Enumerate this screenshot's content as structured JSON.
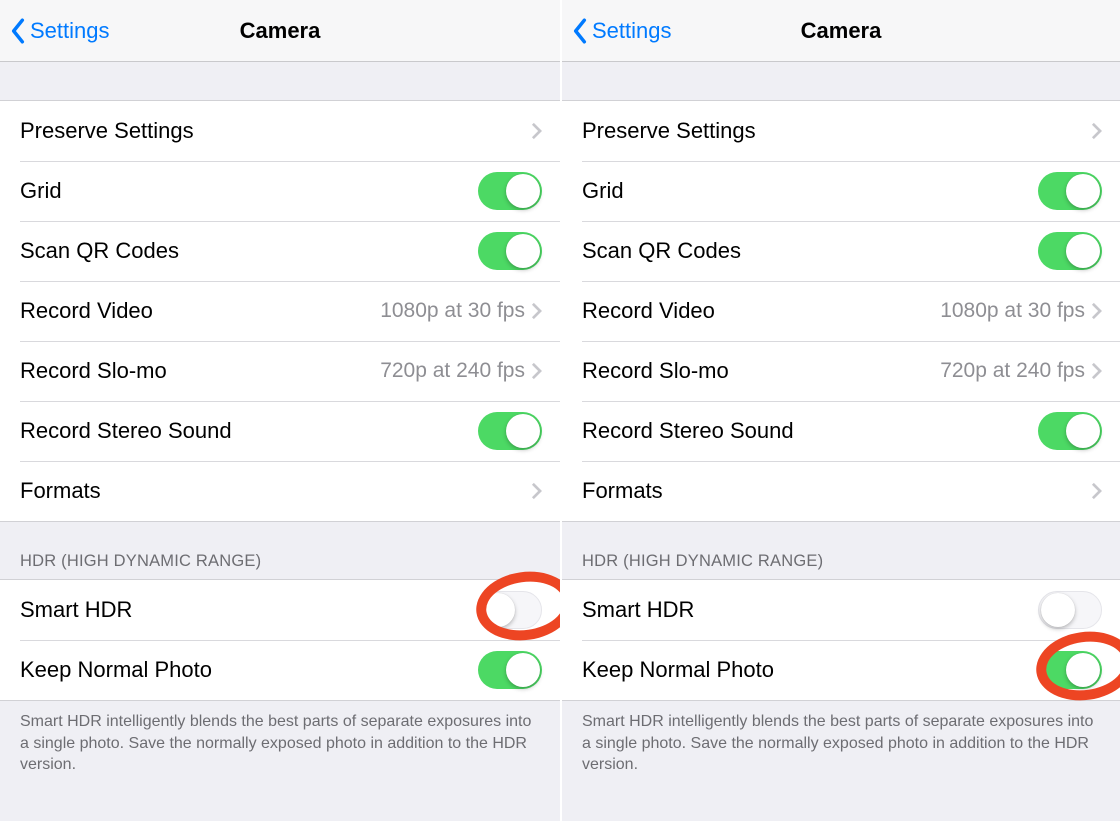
{
  "panels": [
    {
      "back_label": "Settings",
      "title": "Camera",
      "section1": {
        "rows": [
          {
            "kind": "nav",
            "label": "Preserve Settings"
          },
          {
            "kind": "toggle",
            "label": "Grid",
            "on": true
          },
          {
            "kind": "toggle",
            "label": "Scan QR Codes",
            "on": true
          },
          {
            "kind": "nav",
            "label": "Record Video",
            "detail": "1080p at 30 fps"
          },
          {
            "kind": "nav",
            "label": "Record Slo-mo",
            "detail": "720p at 240 fps"
          },
          {
            "kind": "toggle",
            "label": "Record Stereo Sound",
            "on": true
          },
          {
            "kind": "nav",
            "label": "Formats"
          }
        ]
      },
      "section2": {
        "header": "HDR (HIGH DYNAMIC RANGE)",
        "rows": [
          {
            "kind": "toggle",
            "label": "Smart HDR",
            "on": false,
            "circled": true
          },
          {
            "kind": "toggle",
            "label": "Keep Normal Photo",
            "on": true
          }
        ],
        "footer": "Smart HDR intelligently blends the best parts of separate exposures into a single photo. Save the normally exposed photo in addition to the HDR version."
      }
    },
    {
      "back_label": "Settings",
      "title": "Camera",
      "section1": {
        "rows": [
          {
            "kind": "nav",
            "label": "Preserve Settings"
          },
          {
            "kind": "toggle",
            "label": "Grid",
            "on": true
          },
          {
            "kind": "toggle",
            "label": "Scan QR Codes",
            "on": true
          },
          {
            "kind": "nav",
            "label": "Record Video",
            "detail": "1080p at 30 fps"
          },
          {
            "kind": "nav",
            "label": "Record Slo-mo",
            "detail": "720p at 240 fps"
          },
          {
            "kind": "toggle",
            "label": "Record Stereo Sound",
            "on": true
          },
          {
            "kind": "nav",
            "label": "Formats"
          }
        ]
      },
      "section2": {
        "header": "HDR (HIGH DYNAMIC RANGE)",
        "rows": [
          {
            "kind": "toggle",
            "label": "Smart HDR",
            "on": false
          },
          {
            "kind": "toggle",
            "label": "Keep Normal Photo",
            "on": true,
            "circled": true
          }
        ],
        "footer": "Smart HDR intelligently blends the best parts of separate exposures into a single photo. Save the normally exposed photo in addition to the HDR version."
      }
    }
  ]
}
